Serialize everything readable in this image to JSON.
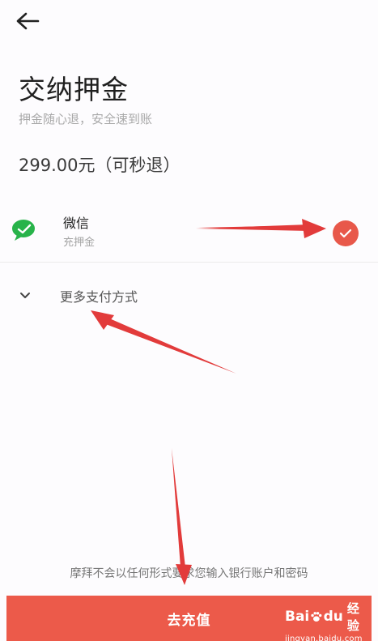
{
  "header": {
    "back_icon": "arrow-left-icon",
    "title": "交纳押金",
    "subtitle": "押金随心退，安全速到账"
  },
  "amount": "299.00元（可秒退）",
  "payment_option": {
    "logo": "wechat-logo",
    "name": "微信",
    "description": "充押金",
    "selected": true,
    "check_icon": "checkmark-circle-icon"
  },
  "more_payment": {
    "icon": "chevron-down-icon",
    "label": "更多支付方式"
  },
  "disclaimer": "摩拜不会以任何形式要求您输入银行账户和密码",
  "submit_button": "去充值",
  "watermark": {
    "brand_left": "Bai",
    "brand_right": "du",
    "product": "经验",
    "url": "jingyan.baidu.com"
  },
  "colors": {
    "accent": "#ec5a4a",
    "annotation_arrow": "#e23b3b",
    "wechat_green": "#28b34a"
  }
}
